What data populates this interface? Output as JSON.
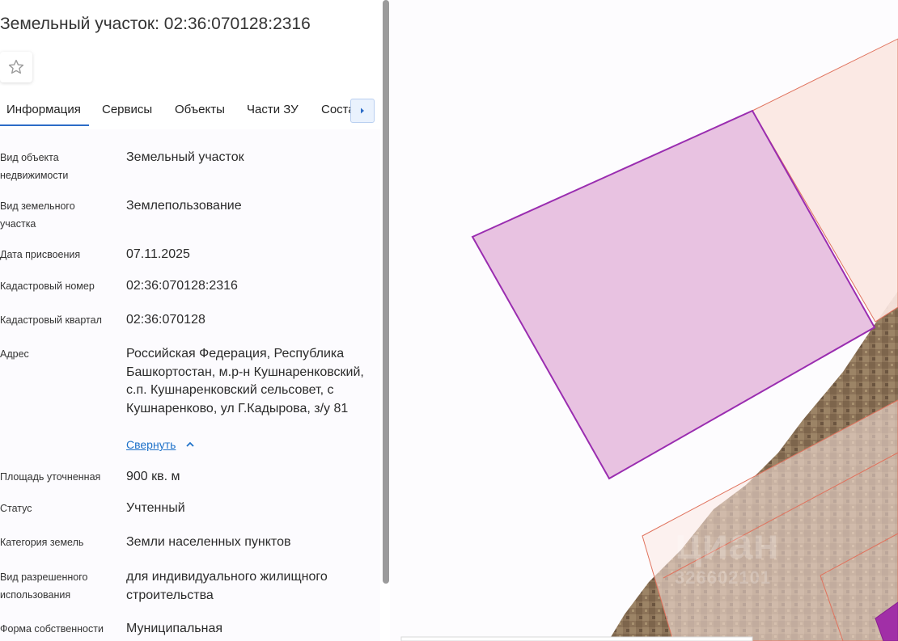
{
  "header": {
    "title": "Земельный участок: 02:36:070128:2316"
  },
  "tabs": [
    {
      "label": "Информация",
      "active": true
    },
    {
      "label": "Сервисы",
      "active": false
    },
    {
      "label": "Объекты",
      "active": false
    },
    {
      "label": "Части ЗУ",
      "active": false
    },
    {
      "label": "Состав",
      "active": false
    }
  ],
  "info": {
    "rows": [
      {
        "label": "Вид объекта недвижимости",
        "value": "Земельный участок"
      },
      {
        "label": "Вид земельного участка",
        "value": "Землепользование"
      },
      {
        "label": "Дата присвоения",
        "value": "07.11.2025"
      },
      {
        "label": "Кадастровый номер",
        "value": "02:36:070128:2316"
      },
      {
        "label": "Кадастровый квартал",
        "value": "02:36:070128"
      },
      {
        "label": "Адрес",
        "value": "Российская Федерация, Республика Башкортостан, м.р-н Кушнаренковский, с.п. Кушнаренковский сельсовет, с Кушнаренково, ул Г.Кадырова, з/у 81"
      },
      {
        "label": "Площадь уточненная",
        "value": "900 кв. м"
      },
      {
        "label": "Статус",
        "value": "Учтенный"
      },
      {
        "label": "Категория земель",
        "value": "Земли населенных пунктов"
      },
      {
        "label": "Вид разрешенного использования",
        "value": "для индивидуального жилищного строительства"
      },
      {
        "label": "Форма собственности",
        "value": "Муниципальная"
      }
    ],
    "collapse_label": "Свернуть"
  },
  "map": {
    "watermark": "циан",
    "watermark_id": "326602101"
  },
  "colors": {
    "accent": "#2c6cc7",
    "link": "#1f72c9",
    "parcel_fill": "#e8c2e1",
    "parcel_stroke": "#9a2db0",
    "neighbor_fill": "#fbe7e2",
    "neighbor_stroke": "#e0735e"
  },
  "icons": {
    "favorite": "star-outline-icon",
    "tabs_next": "caret-right-icon",
    "collapse": "chevron-up-icon"
  }
}
